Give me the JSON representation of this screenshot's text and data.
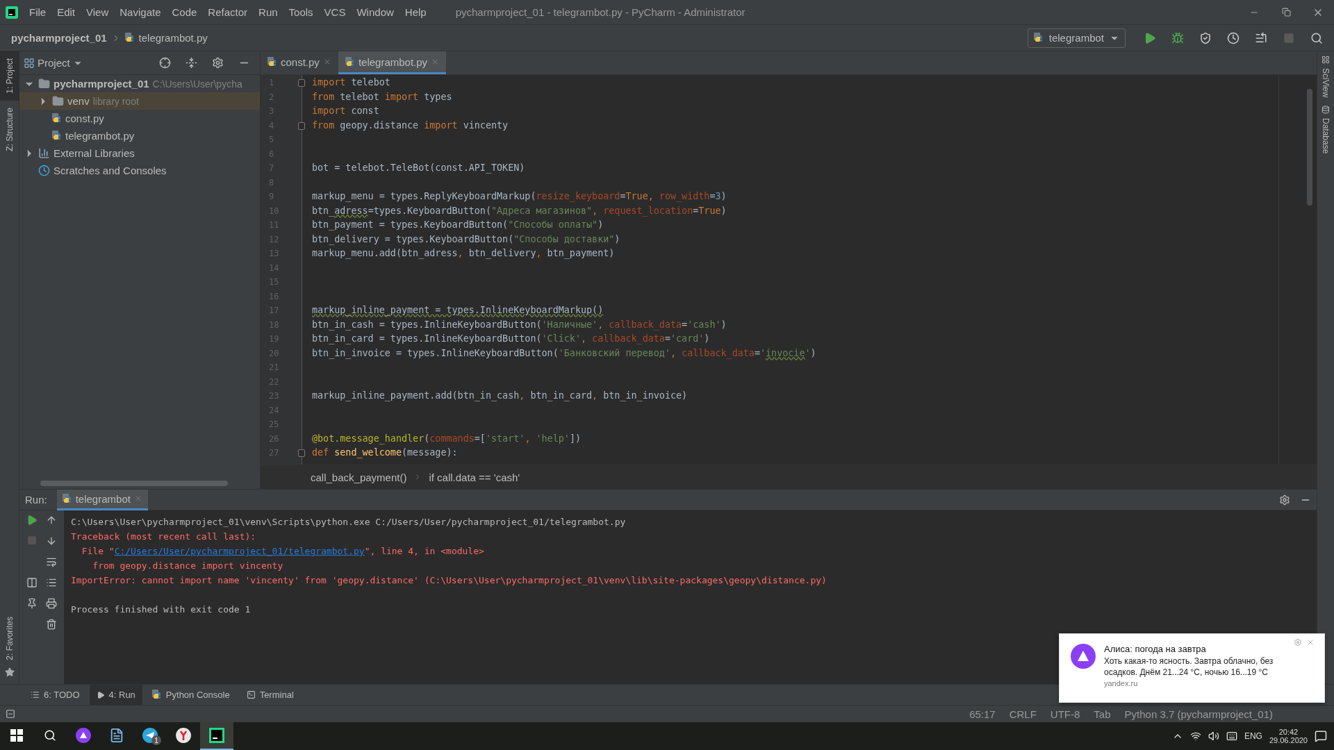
{
  "menu": [
    "File",
    "Edit",
    "View",
    "Navigate",
    "Code",
    "Refactor",
    "Run",
    "Tools",
    "VCS",
    "Window",
    "Help"
  ],
  "window": {
    "title": "pycharmproject_01 - telegrambot.py - PyCharm - Administrator"
  },
  "nav": {
    "project": "pycharmproject_01",
    "file": "telegrambot.py",
    "run_config": "telegrambot"
  },
  "left_stripe": [
    {
      "label": "1: Project",
      "selected": true
    },
    {
      "label": "Z: Structure",
      "selected": false
    }
  ],
  "favorites": "2: Favorites",
  "right_stripe": [
    "SciView",
    "Database"
  ],
  "project_panel": {
    "title": "Project",
    "tree": [
      {
        "label": "pycharmproject_01",
        "hint": "C:\\Users\\User\\pycha",
        "kind": "folder",
        "expanded": true,
        "selected": false,
        "bold": true,
        "children": [
          {
            "label": "venv",
            "hint": "library root",
            "kind": "folder",
            "expanded": false,
            "selected": true
          },
          {
            "label": "const.py",
            "kind": "file",
            "selected": false
          },
          {
            "label": "telegrambot.py",
            "kind": "file",
            "selected": false
          }
        ]
      },
      {
        "label": "External Libraries",
        "kind": "library",
        "expanded": false,
        "selected": false
      },
      {
        "label": "Scratches and Consoles",
        "kind": "scratch",
        "selected": false
      }
    ]
  },
  "editor_tabs": [
    {
      "label": "const.py",
      "selected": false
    },
    {
      "label": "telegrambot.py",
      "selected": true
    }
  ],
  "code": [
    {
      "number": "1",
      "fold": true,
      "tokens": [
        {
          "kind": "kw",
          "text": "import"
        },
        {
          "kind": "plain",
          "text": " telebot"
        }
      ]
    },
    {
      "number": "2",
      "tokens": [
        {
          "kind": "kw",
          "text": "from"
        },
        {
          "kind": "plain",
          "text": " telebot "
        },
        {
          "kind": "kw",
          "text": "import"
        },
        {
          "kind": "plain",
          "text": " types"
        }
      ]
    },
    {
      "number": "3",
      "tokens": [
        {
          "kind": "kw",
          "text": "import"
        },
        {
          "kind": "plain",
          "text": " const"
        }
      ]
    },
    {
      "number": "4",
      "fold": true,
      "tokens": [
        {
          "kind": "kw",
          "text": "from"
        },
        {
          "kind": "plain",
          "text": " geopy.distance "
        },
        {
          "kind": "kw",
          "text": "import"
        },
        {
          "kind": "plain",
          "text": " vincenty"
        }
      ]
    },
    {
      "number": "5"
    },
    {
      "number": "6"
    },
    {
      "number": "7",
      "tokens": [
        {
          "kind": "plain",
          "text": "bot = telebot.TeleBot(const.API_TOKEN)"
        }
      ]
    },
    {
      "number": "8"
    },
    {
      "number": "9",
      "tokens": [
        {
          "kind": "plain",
          "text": "markup_menu = types.ReplyKeyboardMarkup("
        },
        {
          "kind": "param",
          "text": "resize_keyboard"
        },
        {
          "kind": "plain",
          "text": "="
        },
        {
          "kind": "kw",
          "text": "True"
        },
        {
          "kind": "kw",
          "text": ", "
        },
        {
          "kind": "param",
          "text": "row_width"
        },
        {
          "kind": "plain",
          "text": "="
        },
        {
          "kind": "num",
          "text": "3"
        },
        {
          "kind": "plain",
          "text": ")"
        }
      ]
    },
    {
      "number": "10",
      "tokens": [
        {
          "kind": "plain",
          "text": "btn_"
        },
        {
          "kind": "plain",
          "text": "adress",
          "underlined": true
        },
        {
          "kind": "plain",
          "text": "=types.KeyboardButton("
        },
        {
          "kind": "str",
          "text": "\"Адреса магазинов\""
        },
        {
          "kind": "kw",
          "text": ", "
        },
        {
          "kind": "param",
          "text": "request_location"
        },
        {
          "kind": "plain",
          "text": "="
        },
        {
          "kind": "kw",
          "text": "True"
        },
        {
          "kind": "plain",
          "text": ")"
        }
      ]
    },
    {
      "number": "11",
      "tokens": [
        {
          "kind": "plain",
          "text": "btn_payment = types.KeyboardButton("
        },
        {
          "kind": "str",
          "text": "\"Способы оплаты\""
        },
        {
          "kind": "plain",
          "text": ")"
        }
      ]
    },
    {
      "number": "12",
      "tokens": [
        {
          "kind": "plain",
          "text": "btn_delivery = types.KeyboardButton("
        },
        {
          "kind": "str",
          "text": "\"Способы доставки\""
        },
        {
          "kind": "plain",
          "text": ")"
        }
      ]
    },
    {
      "number": "13",
      "tokens": [
        {
          "kind": "plain",
          "text": "markup_menu.add(btn_adress"
        },
        {
          "kind": "kw",
          "text": ", "
        },
        {
          "kind": "plain",
          "text": "btn_delivery"
        },
        {
          "kind": "kw",
          "text": ", "
        },
        {
          "kind": "plain",
          "text": "btn_payment)"
        }
      ]
    },
    {
      "number": "14"
    },
    {
      "number": "15"
    },
    {
      "number": "16"
    },
    {
      "number": "17",
      "tokens": [
        {
          "kind": "plain",
          "text": "markup_inline_payment = types.InlineKeyboardMarkup()",
          "underlined": true
        }
      ]
    },
    {
      "number": "18",
      "tokens": [
        {
          "kind": "plain",
          "text": "btn_in_cash = types.InlineKeyboardButton("
        },
        {
          "kind": "str",
          "text": "'Наличные'"
        },
        {
          "kind": "kw",
          "text": ", "
        },
        {
          "kind": "param",
          "text": "callback_data"
        },
        {
          "kind": "plain",
          "text": "="
        },
        {
          "kind": "str",
          "text": "'cash'"
        },
        {
          "kind": "plain",
          "text": ")"
        }
      ]
    },
    {
      "number": "19",
      "tokens": [
        {
          "kind": "plain",
          "text": "btn_in_card = types.InlineKeyboardButton("
        },
        {
          "kind": "str",
          "text": "'Click'"
        },
        {
          "kind": "kw",
          "text": ", "
        },
        {
          "kind": "param",
          "text": "callback_data"
        },
        {
          "kind": "plain",
          "text": "="
        },
        {
          "kind": "str",
          "text": "'card'"
        },
        {
          "kind": "plain",
          "text": ")"
        }
      ]
    },
    {
      "number": "20",
      "tokens": [
        {
          "kind": "plain",
          "text": "btn_in_invoice = types.InlineKeyboardButton("
        },
        {
          "kind": "str",
          "text": "'Банковский перевод'"
        },
        {
          "kind": "kw",
          "text": ", "
        },
        {
          "kind": "param",
          "text": "callback_data"
        },
        {
          "kind": "plain",
          "text": "="
        },
        {
          "kind": "str",
          "text": "'"
        },
        {
          "kind": "str",
          "text": "invocie",
          "underlined": true
        },
        {
          "kind": "str",
          "text": "'"
        },
        {
          "kind": "plain",
          "text": ")"
        }
      ]
    },
    {
      "number": "21"
    },
    {
      "number": "22"
    },
    {
      "number": "23",
      "tokens": [
        {
          "kind": "plain",
          "text": "markup_inline_payment.add(btn_in_cash"
        },
        {
          "kind": "kw",
          "text": ", "
        },
        {
          "kind": "plain",
          "text": "btn_in_card"
        },
        {
          "kind": "kw",
          "text": ", "
        },
        {
          "kind": "plain",
          "text": "btn_in_invoice)"
        }
      ]
    },
    {
      "number": "24"
    },
    {
      "number": "25"
    },
    {
      "number": "26",
      "tokens": [
        {
          "kind": "deco",
          "text": "@bot.message_handler"
        },
        {
          "kind": "plain",
          "text": "("
        },
        {
          "kind": "param",
          "text": "commands"
        },
        {
          "kind": "plain",
          "text": "=["
        },
        {
          "kind": "str",
          "text": "'start'"
        },
        {
          "kind": "kw",
          "text": ", "
        },
        {
          "kind": "str",
          "text": "'help'"
        },
        {
          "kind": "plain",
          "text": "])"
        }
      ]
    },
    {
      "number": "27",
      "fold": true,
      "tokens": [
        {
          "kind": "kw",
          "text": "def "
        },
        {
          "kind": "fn",
          "text": "send_welcome"
        },
        {
          "kind": "plain",
          "text": "(message):"
        }
      ]
    }
  ],
  "breadcrumb": [
    "call_back_payment()",
    "if call.data == 'cash'"
  ],
  "run": {
    "label": "Run:",
    "tab": "telegrambot",
    "console": [
      {
        "kind": "normal",
        "tokens": [
          {
            "kind": "text",
            "text": "C:\\Users\\User\\pycharmproject_01\\venv\\Scripts\\python.exe C:/Users/User/pycharmproject_01/telegrambot.py"
          }
        ]
      },
      {
        "kind": "error",
        "tokens": [
          {
            "kind": "text",
            "text": "Traceback (most recent call last):"
          }
        ]
      },
      {
        "kind": "error",
        "tokens": [
          {
            "kind": "text",
            "text": "  File \""
          },
          {
            "kind": "link",
            "text": "C:/Users/User/pycharmproject_01/telegrambot.py"
          },
          {
            "kind": "text",
            "text": "\", line 4, in <module>"
          }
        ]
      },
      {
        "kind": "error",
        "tokens": [
          {
            "kind": "text",
            "text": "    from geopy.distance import vincenty"
          }
        ]
      },
      {
        "kind": "error",
        "tokens": [
          {
            "kind": "text",
            "text": "ImportError: cannot import name 'vincenty' from 'geopy.distance' (C:\\Users\\User\\pycharmproject_01\\venv\\lib\\site-packages\\geopy\\distance.py)"
          }
        ]
      },
      {
        "kind": "blank"
      },
      {
        "kind": "normal",
        "tokens": [
          {
            "kind": "text",
            "text": "Process finished with exit code 1"
          }
        ]
      }
    ]
  },
  "tool_tabs": [
    {
      "label": "6: TODO",
      "kind": "todo",
      "selected": false
    },
    {
      "label": "4: Run",
      "kind": "run",
      "selected": true
    },
    {
      "label": "Python Console",
      "kind": "python",
      "selected": false
    },
    {
      "label": "Terminal",
      "kind": "terminal",
      "selected": false
    }
  ],
  "status_bar": [
    "65:17",
    "CRLF",
    "UTF-8",
    "Tab",
    "Python 3.7 (pycharmproject_01)"
  ],
  "notification": {
    "title": "Алиса: погода на завтра",
    "body": "Хоть какая-то ясность. Завтра облачно, без осадков. Днём 21...24 °C, ночью 16...19 °C",
    "source": "yandex.ru"
  },
  "taskbar": {
    "apps": [
      {
        "kind": "alice",
        "selected": false
      },
      {
        "kind": "notepad",
        "selected": false
      },
      {
        "kind": "telegram",
        "selected": false,
        "badge": "1"
      },
      {
        "kind": "yandex",
        "selected": false
      },
      {
        "kind": "pycharm",
        "selected": true
      }
    ],
    "language": "ENG",
    "time": "20:42",
    "date": "29.06.2020"
  }
}
